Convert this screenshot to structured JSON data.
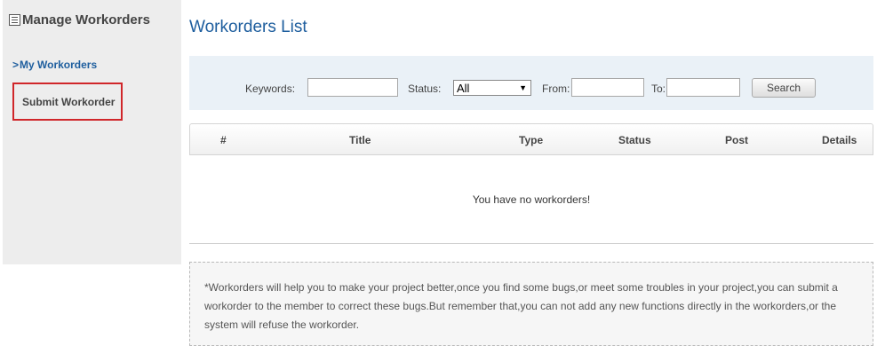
{
  "sidebar": {
    "title": "Manage Workorders",
    "title_icon": "list-icon",
    "items": [
      {
        "label": "My Workorders",
        "active": true,
        "icon": "chevron-right-icon"
      },
      {
        "label": "Submit Workorder",
        "highlighted": true
      }
    ]
  },
  "main": {
    "title": "Workorders List",
    "search": {
      "keywords_label": "Keywords:",
      "keywords_value": "",
      "status_label": "Status:",
      "status_value": "All",
      "from_label": "From:",
      "from_value": "",
      "to_label": "To:",
      "to_value": "",
      "search_button": "Search"
    },
    "table": {
      "columns": [
        "#",
        "Title",
        "Type",
        "Status",
        "Post",
        "Details"
      ],
      "rows": [],
      "empty_message": "You have no workorders!"
    },
    "note": "*Workorders will help you to make your project better,once you find some bugs,or meet some troubles in your project,you can submit a workorder to the member to correct these bugs.But remember that,you can not add any new functions directly in the workorders,or the system will refuse the workorder."
  },
  "colors": {
    "accent": "#1e5e9e",
    "sidebar_bg": "#ededed",
    "search_panel_bg": "#eaf1f7",
    "highlight_border": "#d0262a"
  }
}
